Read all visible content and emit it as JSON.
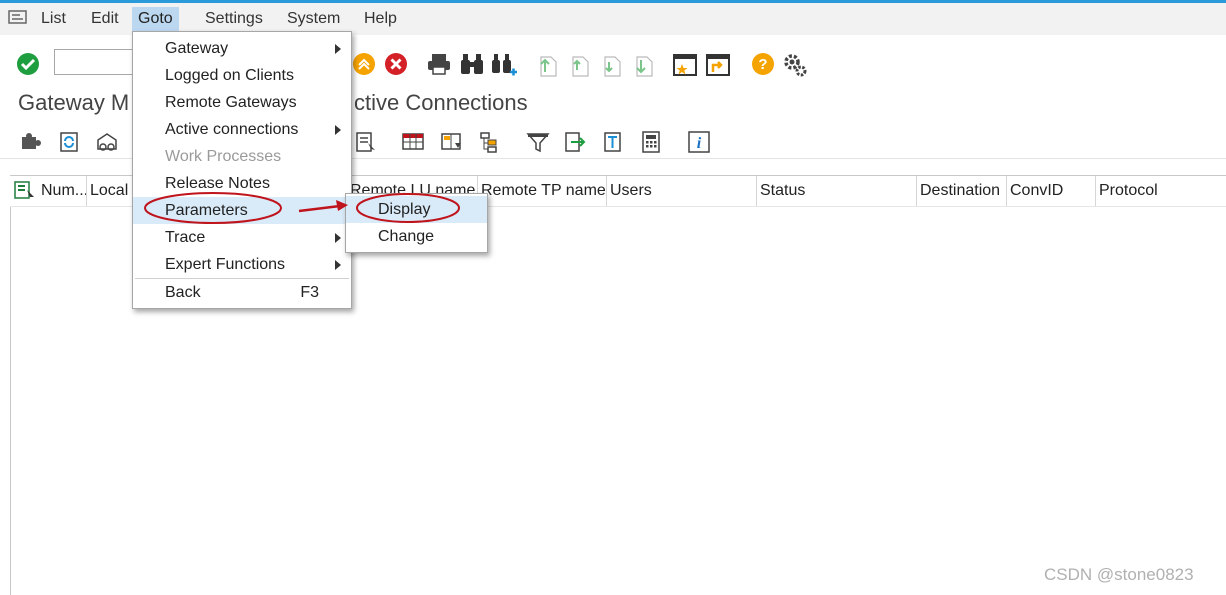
{
  "menubar": {
    "items": [
      {
        "label": "List"
      },
      {
        "label": "Edit"
      },
      {
        "label": "Goto"
      },
      {
        "label": "Settings"
      },
      {
        "label": "System"
      },
      {
        "label": "Help"
      }
    ]
  },
  "title": {
    "left": "Gateway M",
    "right": "ctive Connections"
  },
  "table": {
    "columns": [
      "Num...",
      "Local",
      "Remote LU name",
      "Remote TP name",
      "Users",
      "Status",
      "Destination",
      "ConvID",
      "Protocol"
    ]
  },
  "goto_menu": {
    "items": [
      {
        "label": "Gateway",
        "has_submenu": true,
        "enabled": true
      },
      {
        "label": "Logged on Clients",
        "has_submenu": false,
        "enabled": true
      },
      {
        "label": "Remote Gateways",
        "has_submenu": false,
        "enabled": true
      },
      {
        "label": "Active connections",
        "has_submenu": true,
        "enabled": true
      },
      {
        "label": "Work Processes",
        "has_submenu": false,
        "enabled": false
      },
      {
        "label": "Release Notes",
        "has_submenu": false,
        "enabled": true
      },
      {
        "label": "Parameters",
        "has_submenu": false,
        "enabled": true,
        "highlighted": true
      },
      {
        "label": "Trace",
        "has_submenu": true,
        "enabled": true
      },
      {
        "label": "Expert Functions",
        "has_submenu": true,
        "enabled": true
      },
      {
        "label": "Back",
        "accelerator": "F3",
        "has_submenu": false,
        "enabled": true
      }
    ]
  },
  "parameters_submenu": {
    "items": [
      {
        "label": "Display",
        "highlighted": true
      },
      {
        "label": "Change"
      }
    ]
  },
  "watermark": "CSDN @stone0823",
  "colors": {
    "accent_blue": "#2a9ad8",
    "menu_active": "#bcd8f0",
    "menu_highlight": "#d9eaf8",
    "annotation_red": "#c0141c",
    "ok_green": "#1e9e3e",
    "cancel_red": "#d42027",
    "help_orange": "#f5a300"
  }
}
